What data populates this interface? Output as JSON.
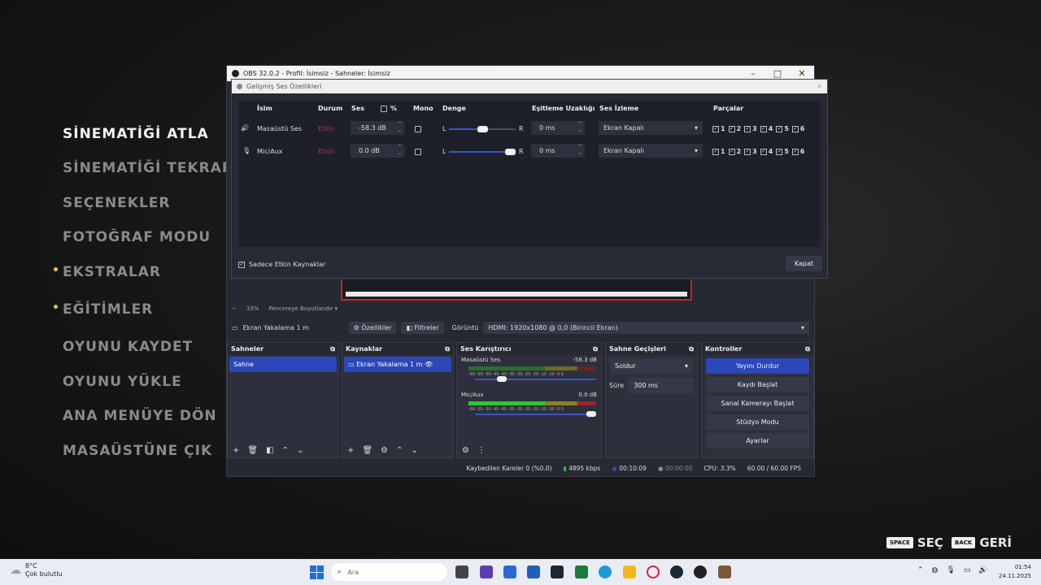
{
  "game_menu": {
    "items": [
      {
        "label": "SİNEMATİĞİ ATLA",
        "active": true,
        "dot": false
      },
      {
        "label": "SİNEMATİĞİ TEKRAR OY",
        "active": false,
        "dot": false
      },
      {
        "label": "SEÇENEKLER",
        "active": false,
        "dot": false
      },
      {
        "label": "FOTOĞRAF MODU",
        "active": false,
        "dot": false
      },
      {
        "label": "EKSTRALAR",
        "active": false,
        "dot": true
      },
      {
        "label": "EĞİTİMLER",
        "active": false,
        "dot": true
      },
      {
        "label": "OYUNU KAYDET",
        "active": false,
        "dot": false
      },
      {
        "label": "OYUNU YÜKLE",
        "active": false,
        "dot": false
      },
      {
        "label": "ANA MENÜYE DÖN",
        "active": false,
        "dot": false
      },
      {
        "label": "MASAÜSTÜNE ÇIK",
        "active": false,
        "dot": false
      }
    ],
    "hints": {
      "select_key": "SPACE",
      "select_label": "SEÇ",
      "back_key": "BACK",
      "back_label": "GERİ"
    }
  },
  "obs": {
    "title": "OBS 32.0.2 - Profil: İsimsiz - Sahneler: İsimsiz",
    "zoom": "33%",
    "zoom_mode": "Pencereye Boyutlandır",
    "source_name": "Ekran Yakalama 1 m",
    "properties_label": "Özellikler",
    "filters_label": "Filtreler",
    "display_label": "Görüntü",
    "display_value": "HDMI: 1920x1080 @ 0,0 (Birincil Ekran)",
    "docks": {
      "scenes": {
        "title": "Sahneler",
        "items": [
          "Sahne"
        ]
      },
      "sources": {
        "title": "Kaynaklar",
        "items": [
          "Ekran Yakalama 1 m"
        ]
      },
      "mixer": {
        "title": "Ses Karıştırıcı",
        "channels": [
          {
            "name": "Masaüstü Ses",
            "db": "-58.3 dB",
            "level": 0.2
          },
          {
            "name": "Mic/Aux",
            "db": "0.0 dB",
            "level": 1.0
          }
        ],
        "scale": "-60 -55 -50 -45 -40 -35 -30 -25 -20 -15 -10 -5 0"
      },
      "transitions": {
        "title": "Sahne Geçişleri",
        "type": "Soldur",
        "duration_label": "Süre",
        "duration": "300 ms"
      },
      "controls": {
        "title": "Kontroller",
        "buttons": [
          "Yayını Durdur",
          "Kaydı Başlat",
          "Sanal Kamerayı Başlat",
          "Stüdyo Modu",
          "Ayarlar"
        ]
      }
    },
    "status": {
      "dropped": "Kaybedilen Kareler 0 (%0.0)",
      "bitrate": "4895 kbps",
      "stream_time": "00:10:09",
      "rec_time": "00:00:00",
      "cpu": "CPU: 3.3%",
      "fps": "60.00 / 60.00 FPS"
    }
  },
  "dialog": {
    "title": "Gelişmiş Ses Özellikleri",
    "headers": {
      "name": "İsim",
      "status": "Durum",
      "volume": "Ses",
      "percent": "%",
      "mono": "Mono",
      "balance": "Denge",
      "sync": "Eşitleme Uzaklığı",
      "monitor": "Ses İzleme",
      "tracks": "Parçalar"
    },
    "rows": [
      {
        "name": "Masaüstü Ses",
        "status": "Etkin",
        "volume": "-58.3 dB",
        "balance": 0.5,
        "sync": "0 ms",
        "monitor": "Ekran Kapalı"
      },
      {
        "name": "Mic/Aux",
        "status": "Etkin",
        "volume": "0.0 dB",
        "balance": 1.0,
        "sync": "0 ms",
        "monitor": "Ekran Kapalı"
      }
    ],
    "balance_left": "L",
    "balance_right": "R",
    "track_numbers": [
      "1",
      "2",
      "3",
      "4",
      "5",
      "6"
    ],
    "active_only_label": "Sadece Etkin Kaynaklar",
    "close_label": "Kapat"
  },
  "taskbar": {
    "weather_temp": "8°C",
    "weather_text": "Çok bulutlu",
    "search_placeholder": "Ara",
    "time": "01:54",
    "date": "24.11.2025"
  },
  "colors": {
    "accent": "#2b47b9",
    "recording_red": "#cc2222",
    "meter_green": "#32c632"
  }
}
